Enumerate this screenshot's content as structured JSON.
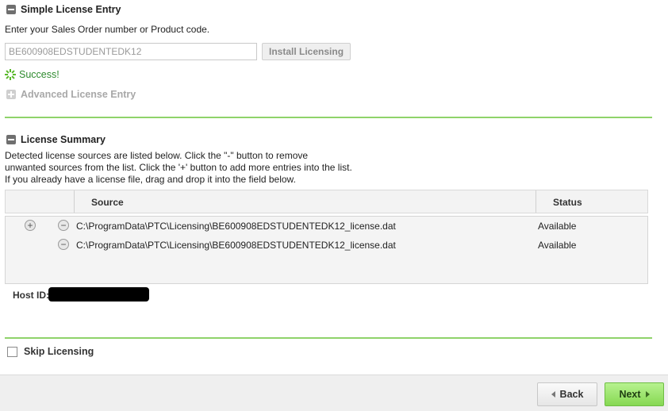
{
  "simple_license": {
    "title": "Simple License Entry",
    "instruction": "Enter your Sales Order number or Product code.",
    "input_value": "BE600908EDSTUDENTEDK12",
    "install_button": "Install Licensing",
    "success_text": "Success!"
  },
  "advanced_license": {
    "title": "Advanced License Entry"
  },
  "license_summary": {
    "title": "License Summary",
    "description_lines": [
      "Detected license sources are listed below. Click the \"-\" button to remove",
      "unwanted sources from the list.  Click the '+' button to add more entries into the list.",
      "If you already have a license file, drag and drop it into the field below."
    ],
    "columns": [
      "Source",
      "Status"
    ],
    "rows": [
      {
        "source": "C:\\ProgramData\\PTC\\Licensing\\BE600908EDSTUDENTEDK12_license.dat",
        "status": "Available"
      },
      {
        "source": "C:\\ProgramData\\PTC\\Licensing\\BE600908EDSTUDENTEDK12_license.dat",
        "status": "Available"
      }
    ],
    "host_id_label": "Host ID:"
  },
  "skip": {
    "label": "Skip Licensing"
  },
  "footer": {
    "back": "Back",
    "next": "Next"
  },
  "colors": {
    "accent_green": "#8fd36a",
    "success_green": "#2e8b2e"
  }
}
